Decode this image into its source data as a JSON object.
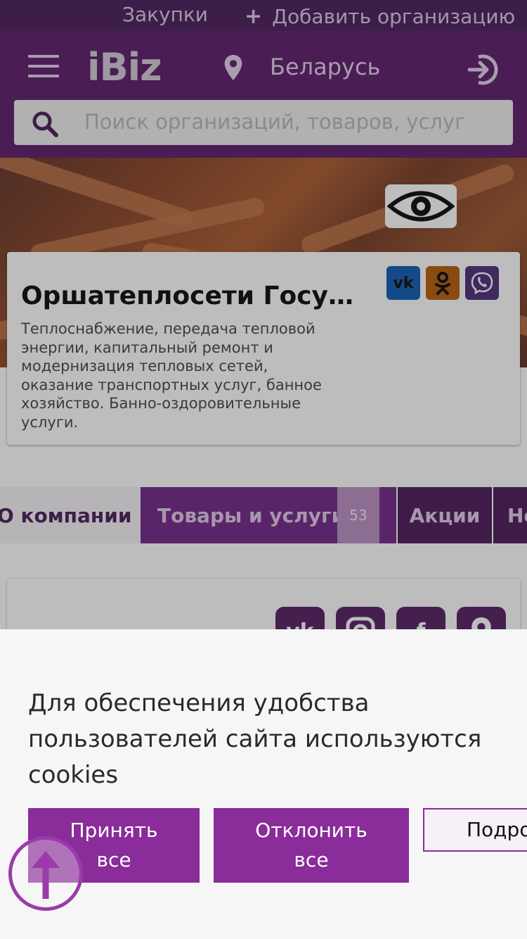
{
  "topbar": {
    "purchases_label": "Закупки",
    "add_org_icon": "plus-icon",
    "add_org_label": "Добавить организацию"
  },
  "header": {
    "logo": "iBiz",
    "country": "Беларусь",
    "search_placeholder": "Поиск организаций, товаров, услуг"
  },
  "company": {
    "title": "Оршатеплосети Госу…",
    "description": "Теплоснабжение, передача тепловой энергии, капитальный ремонт и модернизация тепловых сетей, оказание транспортных услуг, банное хозяйство. Банно-оздоровительные услуги.",
    "social": [
      "vk-icon",
      "odnoklassniki-icon",
      "viber-icon"
    ]
  },
  "tabs": {
    "about": "О компании",
    "goods": "Товары и услуги",
    "goods_count": "53",
    "promo": "Акции",
    "news": "Но"
  },
  "cookie": {
    "message": "Для обеспечения удобства пользователей сайта используются cookies",
    "accept_line1": "Принять",
    "accept_line2": "все",
    "decline_line1": "Отклонить",
    "decline_line2": "все",
    "more": "Подро"
  },
  "colors": {
    "brand_purple": "#8a2c99",
    "overlay_header": "#4a1d55",
    "cookie_bg": "#f6f6f6"
  }
}
